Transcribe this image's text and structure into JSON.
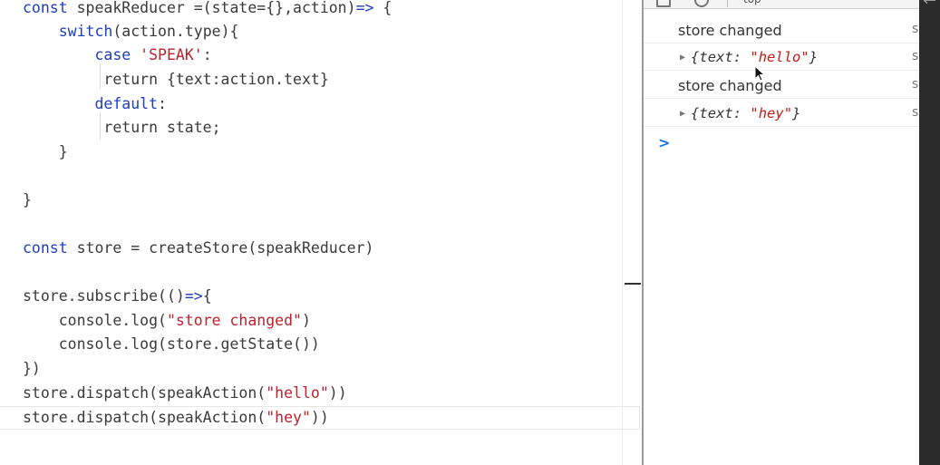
{
  "editor": {
    "lines": [
      [
        {
          "t": "const",
          "c": "k"
        },
        {
          "t": " speakReducer =(state={},action)",
          "c": "p"
        },
        {
          "t": "=>",
          "c": "k"
        },
        {
          "t": " {",
          "c": "p"
        }
      ],
      [
        {
          "t": "    ",
          "c": "p"
        },
        {
          "t": "switch",
          "c": "k"
        },
        {
          "t": "(action.type){",
          "c": "p"
        }
      ],
      [
        {
          "t": "        ",
          "c": "p"
        },
        {
          "t": "case",
          "c": "k"
        },
        {
          "t": " ",
          "c": "p"
        },
        {
          "t": "'SPEAK'",
          "c": "s"
        },
        {
          "t": ":",
          "c": "p"
        }
      ],
      [
        {
          "t": "         return {text:action.text}",
          "c": "p"
        }
      ],
      [
        {
          "t": "        ",
          "c": "p"
        },
        {
          "t": "default",
          "c": "k"
        },
        {
          "t": ":",
          "c": "p"
        }
      ],
      [
        {
          "t": "         return state;",
          "c": "p"
        }
      ],
      [
        {
          "t": "    }",
          "c": "p"
        }
      ],
      [],
      [
        {
          "t": "}",
          "c": "p"
        }
      ],
      [],
      [
        {
          "t": "const",
          "c": "k"
        },
        {
          "t": " store = createStore(speakReducer)",
          "c": "p"
        }
      ],
      [],
      [
        {
          "t": "store.subscribe(()",
          "c": "p"
        },
        {
          "t": "=>",
          "c": "k"
        },
        {
          "t": "{",
          "c": "p"
        }
      ],
      [
        {
          "t": "    console.log(",
          "c": "p"
        },
        {
          "t": "\"store changed\"",
          "c": "s"
        },
        {
          "t": ")",
          "c": "p"
        }
      ],
      [
        {
          "t": "    console.log(store.getState())",
          "c": "p"
        }
      ],
      [
        {
          "t": "})",
          "c": "p"
        }
      ],
      [
        {
          "t": "store.dispatch(speakAction(",
          "c": "p"
        },
        {
          "t": "\"hello\"",
          "c": "s"
        },
        {
          "t": "))",
          "c": "p"
        }
      ],
      [
        {
          "t": "store.dispatch(speakAction(",
          "c": "p"
        },
        {
          "t": "\"hey\"",
          "c": "s"
        },
        {
          "t": "))",
          "c": "p"
        }
      ]
    ]
  },
  "devtools": {
    "toolbar_label": "top",
    "logs": [
      {
        "kind": "text",
        "message": "store changed",
        "source": "s"
      },
      {
        "kind": "object",
        "key": "text",
        "value": "\"hello\"",
        "source": "s"
      },
      {
        "kind": "text",
        "message": "store changed",
        "source": "s"
      },
      {
        "kind": "object",
        "key": "text",
        "value": "\"hey\"",
        "source": "s"
      }
    ],
    "prompt": ">"
  },
  "colors": {
    "keyword": "#1e3dbd",
    "string": "#c41a16",
    "prompt": "#1a73e8"
  }
}
